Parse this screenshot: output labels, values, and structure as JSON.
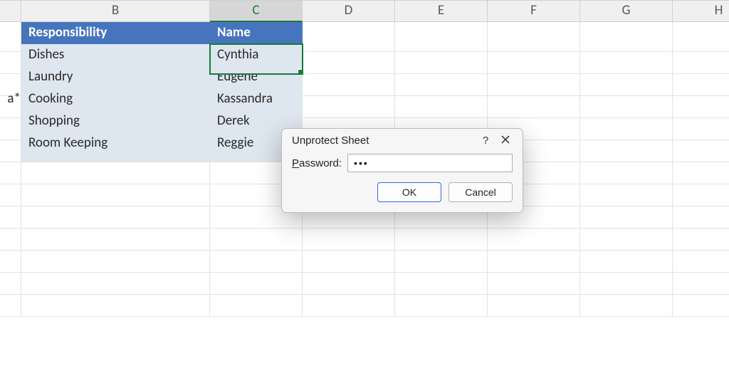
{
  "columns": [
    "B",
    "C",
    "D",
    "E",
    "F",
    "G",
    "H"
  ],
  "active_column_index": 1,
  "left_stub_partial": "a*",
  "headers": {
    "responsibility": "Responsibility",
    "name": "Name"
  },
  "rows": [
    {
      "responsibility": "Dishes",
      "name": "Cynthia"
    },
    {
      "responsibility": "Laundry",
      "name": "Eugene"
    },
    {
      "responsibility": "Cooking",
      "name": "Kassandra"
    },
    {
      "responsibility": "Shopping",
      "name": "Derek"
    },
    {
      "responsibility": "Room Keeping",
      "name": "Reggie"
    }
  ],
  "selected_cell_value": "Cynthia",
  "dialog": {
    "title": "Unprotect Sheet",
    "help_symbol": "?",
    "password_label_prefix": "P",
    "password_label_rest": "assword:",
    "password_masked": "●●●",
    "ok": "OK",
    "cancel": "Cancel"
  }
}
